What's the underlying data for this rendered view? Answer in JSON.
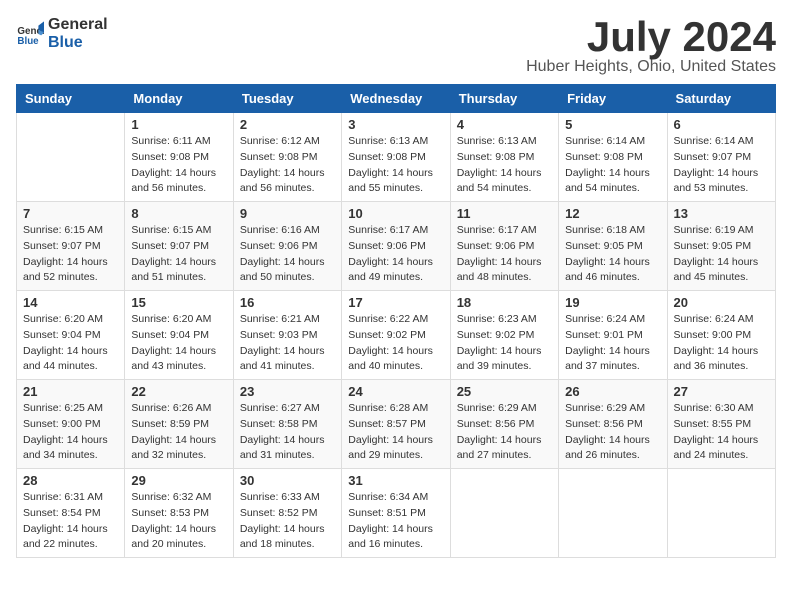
{
  "header": {
    "logo_general": "General",
    "logo_blue": "Blue",
    "month_year": "July 2024",
    "location": "Huber Heights, Ohio, United States"
  },
  "weekdays": [
    "Sunday",
    "Monday",
    "Tuesday",
    "Wednesday",
    "Thursday",
    "Friday",
    "Saturday"
  ],
  "weeks": [
    [
      {
        "day": "",
        "sunrise": "",
        "sunset": "",
        "daylight": ""
      },
      {
        "day": "1",
        "sunrise": "Sunrise: 6:11 AM",
        "sunset": "Sunset: 9:08 PM",
        "daylight": "Daylight: 14 hours and 56 minutes."
      },
      {
        "day": "2",
        "sunrise": "Sunrise: 6:12 AM",
        "sunset": "Sunset: 9:08 PM",
        "daylight": "Daylight: 14 hours and 56 minutes."
      },
      {
        "day": "3",
        "sunrise": "Sunrise: 6:13 AM",
        "sunset": "Sunset: 9:08 PM",
        "daylight": "Daylight: 14 hours and 55 minutes."
      },
      {
        "day": "4",
        "sunrise": "Sunrise: 6:13 AM",
        "sunset": "Sunset: 9:08 PM",
        "daylight": "Daylight: 14 hours and 54 minutes."
      },
      {
        "day": "5",
        "sunrise": "Sunrise: 6:14 AM",
        "sunset": "Sunset: 9:08 PM",
        "daylight": "Daylight: 14 hours and 54 minutes."
      },
      {
        "day": "6",
        "sunrise": "Sunrise: 6:14 AM",
        "sunset": "Sunset: 9:07 PM",
        "daylight": "Daylight: 14 hours and 53 minutes."
      }
    ],
    [
      {
        "day": "7",
        "sunrise": "Sunrise: 6:15 AM",
        "sunset": "Sunset: 9:07 PM",
        "daylight": "Daylight: 14 hours and 52 minutes."
      },
      {
        "day": "8",
        "sunrise": "Sunrise: 6:15 AM",
        "sunset": "Sunset: 9:07 PM",
        "daylight": "Daylight: 14 hours and 51 minutes."
      },
      {
        "day": "9",
        "sunrise": "Sunrise: 6:16 AM",
        "sunset": "Sunset: 9:06 PM",
        "daylight": "Daylight: 14 hours and 50 minutes."
      },
      {
        "day": "10",
        "sunrise": "Sunrise: 6:17 AM",
        "sunset": "Sunset: 9:06 PM",
        "daylight": "Daylight: 14 hours and 49 minutes."
      },
      {
        "day": "11",
        "sunrise": "Sunrise: 6:17 AM",
        "sunset": "Sunset: 9:06 PM",
        "daylight": "Daylight: 14 hours and 48 minutes."
      },
      {
        "day": "12",
        "sunrise": "Sunrise: 6:18 AM",
        "sunset": "Sunset: 9:05 PM",
        "daylight": "Daylight: 14 hours and 46 minutes."
      },
      {
        "day": "13",
        "sunrise": "Sunrise: 6:19 AM",
        "sunset": "Sunset: 9:05 PM",
        "daylight": "Daylight: 14 hours and 45 minutes."
      }
    ],
    [
      {
        "day": "14",
        "sunrise": "Sunrise: 6:20 AM",
        "sunset": "Sunset: 9:04 PM",
        "daylight": "Daylight: 14 hours and 44 minutes."
      },
      {
        "day": "15",
        "sunrise": "Sunrise: 6:20 AM",
        "sunset": "Sunset: 9:04 PM",
        "daylight": "Daylight: 14 hours and 43 minutes."
      },
      {
        "day": "16",
        "sunrise": "Sunrise: 6:21 AM",
        "sunset": "Sunset: 9:03 PM",
        "daylight": "Daylight: 14 hours and 41 minutes."
      },
      {
        "day": "17",
        "sunrise": "Sunrise: 6:22 AM",
        "sunset": "Sunset: 9:02 PM",
        "daylight": "Daylight: 14 hours and 40 minutes."
      },
      {
        "day": "18",
        "sunrise": "Sunrise: 6:23 AM",
        "sunset": "Sunset: 9:02 PM",
        "daylight": "Daylight: 14 hours and 39 minutes."
      },
      {
        "day": "19",
        "sunrise": "Sunrise: 6:24 AM",
        "sunset": "Sunset: 9:01 PM",
        "daylight": "Daylight: 14 hours and 37 minutes."
      },
      {
        "day": "20",
        "sunrise": "Sunrise: 6:24 AM",
        "sunset": "Sunset: 9:00 PM",
        "daylight": "Daylight: 14 hours and 36 minutes."
      }
    ],
    [
      {
        "day": "21",
        "sunrise": "Sunrise: 6:25 AM",
        "sunset": "Sunset: 9:00 PM",
        "daylight": "Daylight: 14 hours and 34 minutes."
      },
      {
        "day": "22",
        "sunrise": "Sunrise: 6:26 AM",
        "sunset": "Sunset: 8:59 PM",
        "daylight": "Daylight: 14 hours and 32 minutes."
      },
      {
        "day": "23",
        "sunrise": "Sunrise: 6:27 AM",
        "sunset": "Sunset: 8:58 PM",
        "daylight": "Daylight: 14 hours and 31 minutes."
      },
      {
        "day": "24",
        "sunrise": "Sunrise: 6:28 AM",
        "sunset": "Sunset: 8:57 PM",
        "daylight": "Daylight: 14 hours and 29 minutes."
      },
      {
        "day": "25",
        "sunrise": "Sunrise: 6:29 AM",
        "sunset": "Sunset: 8:56 PM",
        "daylight": "Daylight: 14 hours and 27 minutes."
      },
      {
        "day": "26",
        "sunrise": "Sunrise: 6:29 AM",
        "sunset": "Sunset: 8:56 PM",
        "daylight": "Daylight: 14 hours and 26 minutes."
      },
      {
        "day": "27",
        "sunrise": "Sunrise: 6:30 AM",
        "sunset": "Sunset: 8:55 PM",
        "daylight": "Daylight: 14 hours and 24 minutes."
      }
    ],
    [
      {
        "day": "28",
        "sunrise": "Sunrise: 6:31 AM",
        "sunset": "Sunset: 8:54 PM",
        "daylight": "Daylight: 14 hours and 22 minutes."
      },
      {
        "day": "29",
        "sunrise": "Sunrise: 6:32 AM",
        "sunset": "Sunset: 8:53 PM",
        "daylight": "Daylight: 14 hours and 20 minutes."
      },
      {
        "day": "30",
        "sunrise": "Sunrise: 6:33 AM",
        "sunset": "Sunset: 8:52 PM",
        "daylight": "Daylight: 14 hours and 18 minutes."
      },
      {
        "day": "31",
        "sunrise": "Sunrise: 6:34 AM",
        "sunset": "Sunset: 8:51 PM",
        "daylight": "Daylight: 14 hours and 16 minutes."
      },
      {
        "day": "",
        "sunrise": "",
        "sunset": "",
        "daylight": ""
      },
      {
        "day": "",
        "sunrise": "",
        "sunset": "",
        "daylight": ""
      },
      {
        "day": "",
        "sunrise": "",
        "sunset": "",
        "daylight": ""
      }
    ]
  ]
}
